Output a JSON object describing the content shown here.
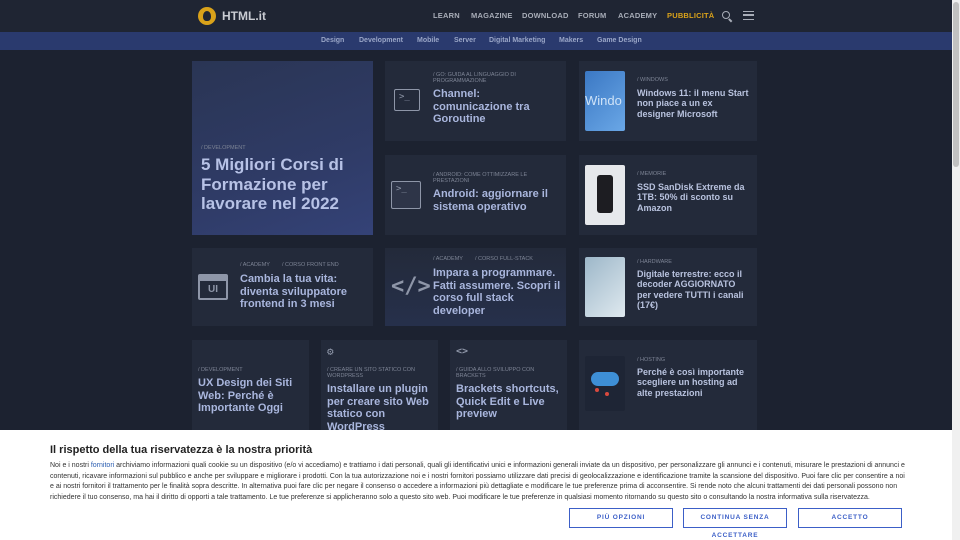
{
  "brand": "HTML.it",
  "nav": [
    "LEARN",
    "MAGAZINE",
    "DOWNLOAD",
    "FORUM",
    "ACADEMY",
    "PUBBLICITÀ"
  ],
  "categories": [
    "Design",
    "Development",
    "Mobile",
    "Server",
    "Digital Marketing",
    "Makers",
    "Game Design"
  ],
  "cards": {
    "featured": {
      "tag": "/ DEVELOPMENT",
      "title": "5 Migliori Corsi di Formazione per lavorare nel 2022"
    },
    "go": {
      "tag": "/ GO: GUIDA AL LINGUAGGIO DI PROGRAMMAZIONE",
      "title": "Channel: comunicazione tra Goroutine"
    },
    "android": {
      "tag": "/ ANDROID: COME OTTIMIZZARE LE PRESTAZIONI",
      "title": "Android: aggiornare il sistema operativo"
    },
    "frontend": {
      "tag1": "/ ACADEMY",
      "tag2": "/ CORSO FRONT END",
      "title": "Cambia la tua vita: diventa sviluppatore frontend in 3 mesi"
    },
    "fullstack": {
      "tag1": "/ ACADEMY",
      "tag2": "/ CORSO FULL-STACK",
      "title": "Impara a programmare. Fatti assumere. Scopri il corso full stack developer"
    },
    "ux": {
      "tag": "/ DEVELOPMENT",
      "title": "UX Design dei Siti Web: Perché è Importante Oggi"
    },
    "wordpress": {
      "tag": "/ CREARE UN SITO STATICO CON WORDPRESS",
      "title": "Installare un plugin per creare sito Web statico con WordPress"
    },
    "brackets": {
      "tag": "/ GUIDA ALLO SVILUPPO CON BRACKETS",
      "title": "Brackets shortcuts, Quick Edit e Live preview"
    },
    "windows": {
      "tag": "/ WINDOWS",
      "title": "Windows 11: il menu Start non piace a un ex designer Microsoft",
      "thumb_text": "Windo"
    },
    "ssd": {
      "tag": "/ MEMORIE",
      "title": "SSD SanDisk Extreme da 1TB: 50% di sconto su Amazon"
    },
    "decoder": {
      "tag": "/ HARDWARE",
      "title": "Digitale terrestre: ecco il decoder AGGIORNATO per vedere TUTTI i canali (17€)"
    },
    "hosting": {
      "tag": "/ HOSTING",
      "title": "Perché è così importante scegliere un hosting ad alte prestazioni"
    }
  },
  "cookie": {
    "heading": "Il rispetto della tua riservatezza è la nostra priorità",
    "text_before": "Noi e i nostri ",
    "link": "fornitori",
    "text_after": " archiviamo informazioni quali cookie su un dispositivo (e/o vi accediamo) e trattiamo i dati personali, quali gli identificativi unici e informazioni generali inviate da un dispositivo, per personalizzare gli annunci e i contenuti, misurare le prestazioni di annunci e contenuti, ricavare informazioni sul pubblico e anche per sviluppare e migliorare i prodotti. Con la tua autorizzazione noi e i nostri fornitori possiamo utilizzare dati precisi di geolocalizzazione e identificazione tramite la scansione del dispositivo. Puoi fare clic per consentire a noi e ai nostri fornitori il trattamento per le finalità sopra descritte. In alternativa puoi fare clic per negare il consenso o accedere a informazioni più dettagliate e modificare le tue preferenze prima di acconsentire. Si rende noto che alcuni trattamenti dei dati personali possono non richiedere il tuo consenso, ma hai il diritto di opporti a tale trattamento. Le tue preferenze si applicheranno solo a questo sito web. Puoi modificare le tue preferenze in qualsiasi momento ritornando su questo sito o consultando la nostra informativa sulla riservatezza.",
    "buttons": {
      "more": "PIÙ OPZIONI",
      "reject": "CONTINUA SENZA ACCETTARE",
      "accept": "ACCETTO"
    }
  },
  "colors": {
    "accent": "#d9a21a",
    "category_bar": "#2a3a6e",
    "button": "#3c5fc7"
  }
}
